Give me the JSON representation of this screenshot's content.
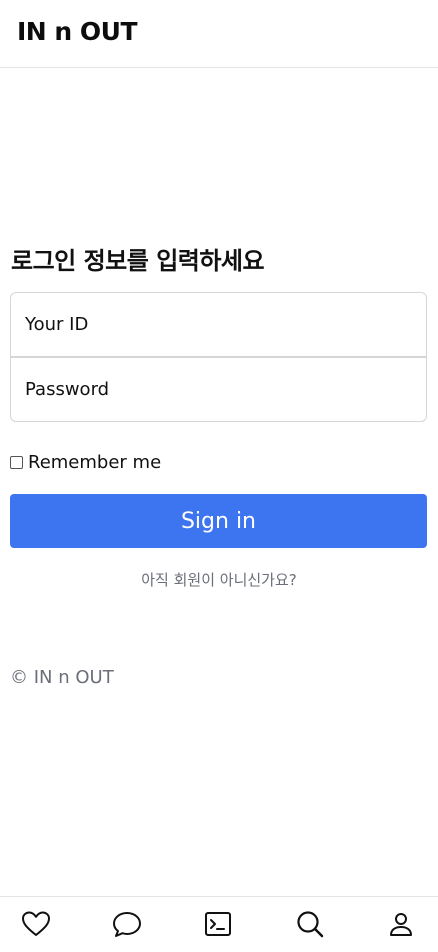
{
  "header": {
    "brand": "IN n OUT"
  },
  "login": {
    "heading": "로그인 정보를 입력하세요",
    "id_placeholder": "Your ID",
    "password_placeholder": "Password",
    "remember_label": "Remember me",
    "remember_checked": false,
    "signin_label": "Sign in",
    "signup_link": "아직 회원이 아니신가요?"
  },
  "footer": {
    "copyright": "© IN n OUT"
  },
  "bottom_nav": {
    "items": [
      {
        "icon": "heart-icon"
      },
      {
        "icon": "chat-bubble-icon"
      },
      {
        "icon": "terminal-icon"
      },
      {
        "icon": "search-icon"
      },
      {
        "icon": "user-icon"
      }
    ]
  },
  "colors": {
    "accent": "#3d74ef",
    "muted_text": "#6b6f78"
  }
}
